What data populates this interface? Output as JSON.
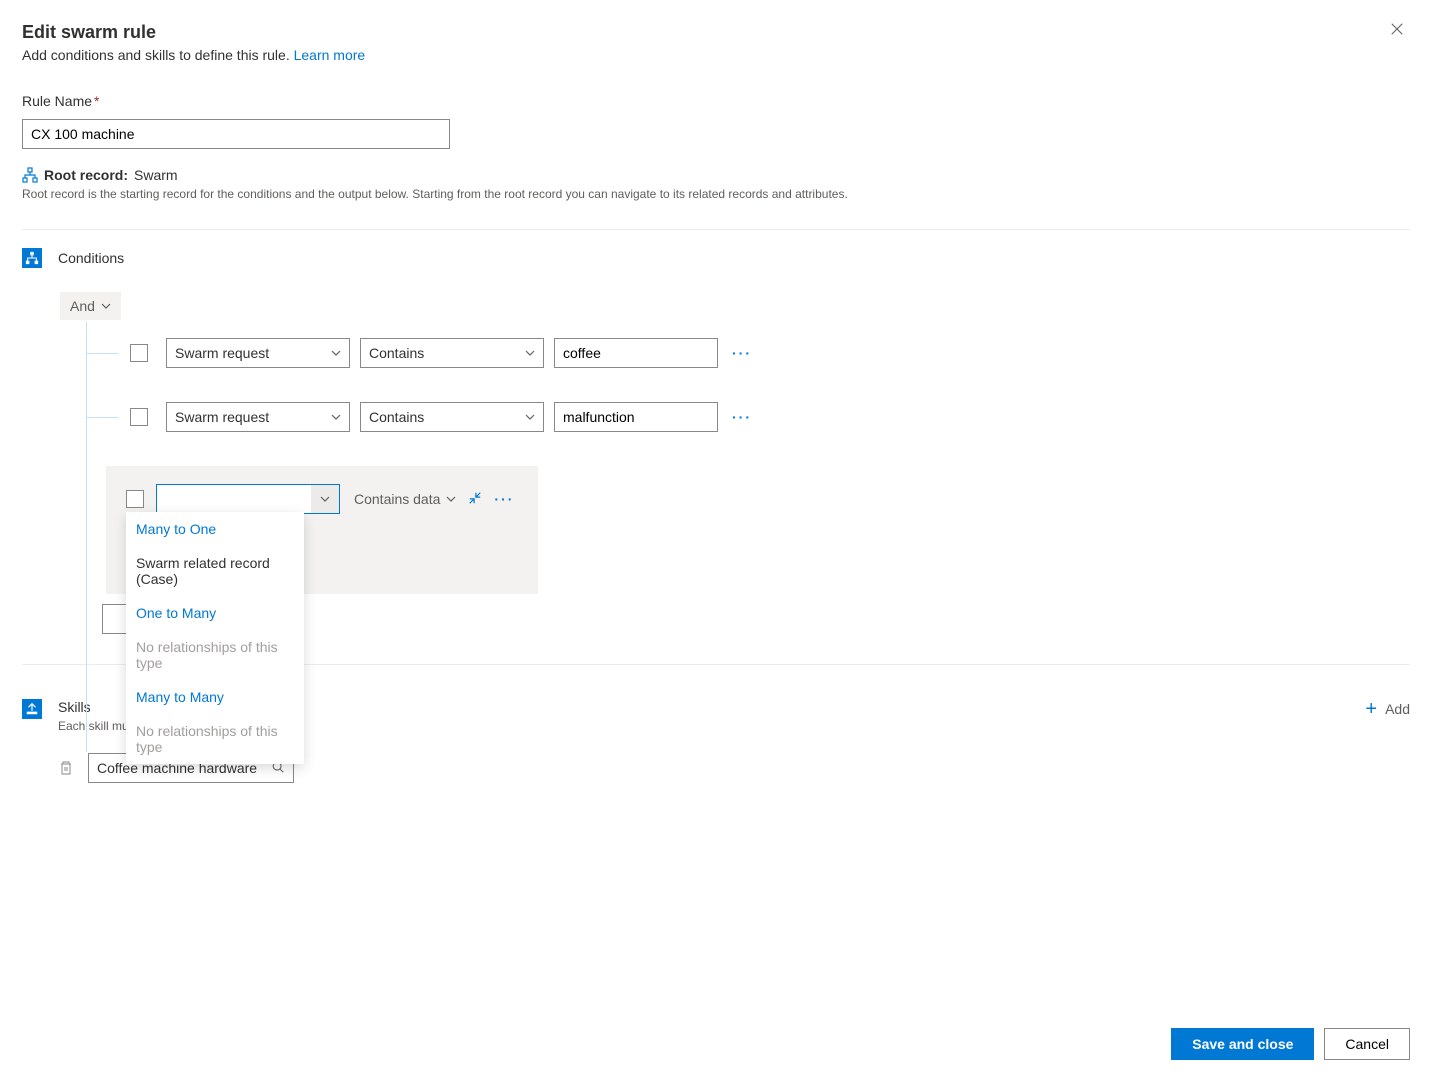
{
  "header": {
    "title": "Edit swarm rule",
    "subtitle": "Add conditions and skills to define this rule.",
    "learn_more": "Learn more"
  },
  "rule_name": {
    "label": "Rule Name",
    "value": "CX 100 machine"
  },
  "root_record": {
    "label": "Root record:",
    "value": "Swarm",
    "help": "Root record is the starting record for the conditions and the output below. Starting from the root record you can navigate to its related records and attributes."
  },
  "conditions": {
    "section_title": "Conditions",
    "group_operator": "And",
    "rows": [
      {
        "field": "Swarm request",
        "operator": "Contains",
        "value": "coffee"
      },
      {
        "field": "Swarm request",
        "operator": "Contains",
        "value": "malfunction"
      }
    ],
    "related": {
      "condition_operator": "Contains data",
      "dropdown": {
        "groups": [
          {
            "header": "Many to One",
            "items": [
              "Swarm related record (Case)"
            ]
          },
          {
            "header": "One to Many",
            "empty": "No relationships of this type"
          },
          {
            "header": "Many to Many",
            "empty": "No relationships of this type"
          }
        ]
      }
    }
  },
  "skills": {
    "section_title": "Skills",
    "subtitle": "Each skill must be unique.",
    "add_label": "Add",
    "items": [
      {
        "value": "Coffee machine hardware"
      }
    ]
  },
  "footer": {
    "save": "Save and close",
    "cancel": "Cancel"
  }
}
